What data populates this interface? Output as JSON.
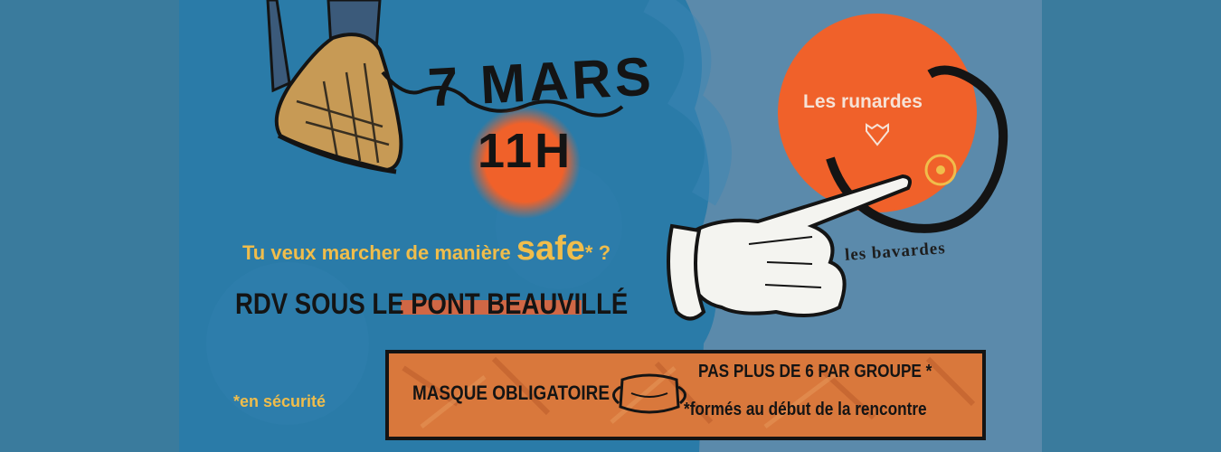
{
  "event": {
    "date": "7 MARS",
    "hour": "11H",
    "question_prefix": "Tu veux marcher de manière",
    "question_emphasis": "safe",
    "question_suffix": "* ?",
    "meeting_point": "RDV SOUS LE PONT BEAUVILLÉ",
    "footnote": "*en sécurité"
  },
  "rules": {
    "mask": "MASQUE OBLIGATOIRE",
    "group_limit": "PAS PLUS DE 6 PAR GROUPE *",
    "group_note": "*formés au début de la rencontre"
  },
  "logos": {
    "runardes": "Les runardes",
    "bavardes": "les bavardes"
  },
  "icons": [
    "sneaker-illustration",
    "pointing-hand-illustration",
    "face-mask-icon",
    "fox-icon",
    "target-icon"
  ],
  "colors": {
    "page_background": "#3a7b9d",
    "poster_blue_left": "#2a7ba8",
    "poster_blue_right": "#5b8aab",
    "orange": "#f0612a",
    "yellow_text": "#f0bd4b",
    "dark_text": "#141414"
  }
}
